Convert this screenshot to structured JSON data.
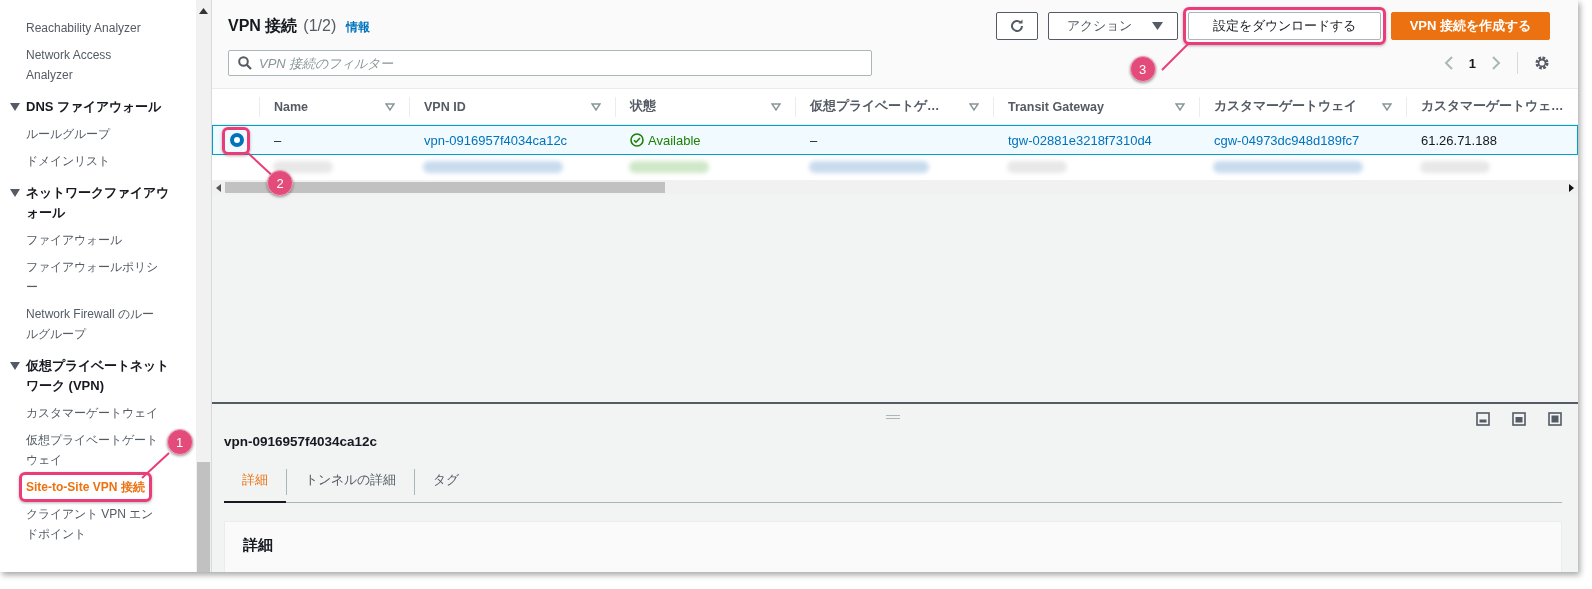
{
  "sidebar": {
    "sections": [
      {
        "items": [
          {
            "label": "Reachability Analyzer",
            "selected": false
          },
          {
            "label": "Network Access Analyzer",
            "selected": false
          }
        ]
      },
      {
        "title": "DNS ファイアウォール",
        "expanded": true,
        "items": [
          {
            "label": "ルールグループ",
            "selected": false
          },
          {
            "label": "ドメインリスト",
            "selected": false
          }
        ]
      },
      {
        "title": "ネットワークファイアウォール",
        "expanded": true,
        "items": [
          {
            "label": "ファイアウォール",
            "selected": false
          },
          {
            "label": "ファイアウォールポリシー",
            "selected": false
          },
          {
            "label": "Network Firewall のルールグループ",
            "selected": false
          }
        ]
      },
      {
        "title": "仮想プライベートネットワーク (VPN)",
        "expanded": true,
        "items": [
          {
            "label": "カスタマーゲートウェイ",
            "selected": false
          },
          {
            "label": "仮想プライベートゲートウェイ",
            "selected": false
          },
          {
            "label": "Site-to-Site VPN 接続",
            "selected": true,
            "callout": "1"
          },
          {
            "label": "クライアント VPN エンドポイント",
            "selected": false
          }
        ]
      }
    ]
  },
  "header": {
    "title": "VPN 接続",
    "count": "(1/2)",
    "info_link": "情報"
  },
  "toolbar": {
    "buttons": [
      {
        "kind": "refresh"
      },
      {
        "kind": "dropdown",
        "label": "アクション"
      },
      {
        "kind": "normal",
        "label": "設定をダウンロードする",
        "callout": "3"
      },
      {
        "kind": "primary",
        "label": "VPN 接続を作成する"
      }
    ]
  },
  "filter": {
    "placeholder": "VPN 接続のフィルター"
  },
  "pagination": {
    "page": "1"
  },
  "table": {
    "columns": [
      {
        "label": "Name",
        "sortable": true
      },
      {
        "label": "VPN ID",
        "sortable": true
      },
      {
        "label": "状態",
        "sortable": true
      },
      {
        "label": "仮想プライベートゲ…",
        "sortable": true
      },
      {
        "label": "Transit Gateway",
        "sortable": true
      },
      {
        "label": "カスタマーゲートウェイ",
        "sortable": true
      },
      {
        "label": "カスタマーゲートウェ…",
        "sortable": false
      }
    ],
    "rows": [
      {
        "selected": true,
        "callout": "2",
        "cells": [
          {
            "kind": "text",
            "text": "–"
          },
          {
            "kind": "link",
            "text": "vpn-0916957f4034ca12c"
          },
          {
            "kind": "status",
            "text": "Available"
          },
          {
            "kind": "text",
            "text": "–"
          },
          {
            "kind": "link",
            "text": "tgw-02881e3218f7310d4"
          },
          {
            "kind": "link",
            "text": "cgw-04973dc948d189fc7"
          },
          {
            "kind": "text",
            "text": "61.26.71.188"
          }
        ]
      }
    ]
  },
  "details": {
    "title": "vpn-0916957f4034ca12c",
    "tabs": [
      {
        "label": "詳細",
        "selected": true
      },
      {
        "label": "トンネルの詳細",
        "selected": false
      },
      {
        "label": "タグ",
        "selected": false
      }
    ],
    "card_title": "詳細"
  }
}
